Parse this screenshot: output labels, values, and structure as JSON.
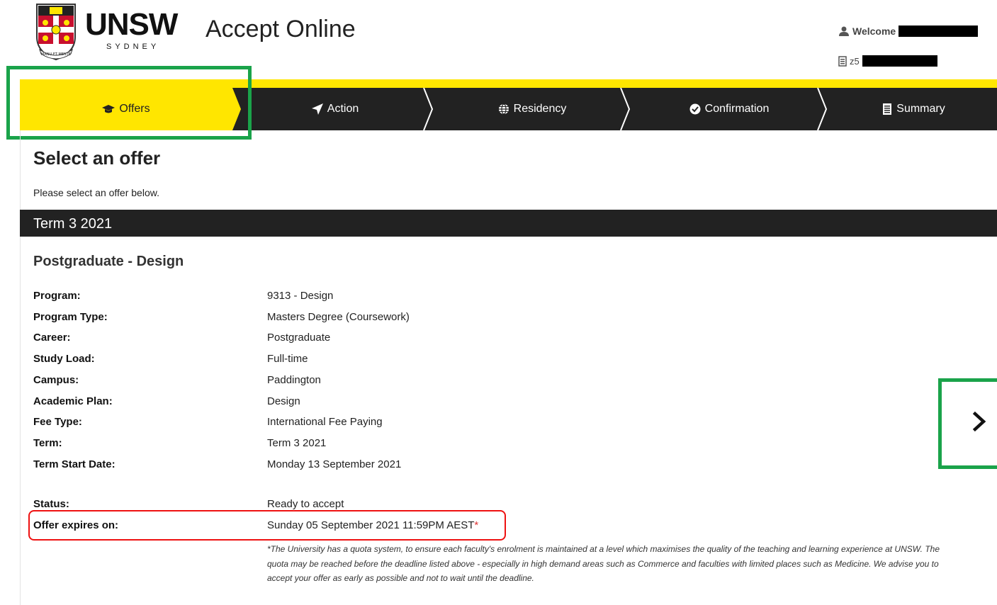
{
  "header": {
    "brand_main": "UNSW",
    "brand_sub": "SYDNEY",
    "crest_motto": "MANU ET MENTE",
    "app_title": "Accept Online",
    "welcome_label": "Welcome",
    "student_id_prefix": "z5"
  },
  "nav": {
    "steps": [
      {
        "label": "Offers",
        "icon": "graduation-cap-icon",
        "active": true
      },
      {
        "label": "Action",
        "icon": "paper-plane-icon",
        "active": false
      },
      {
        "label": "Residency",
        "icon": "globe-icon",
        "active": false
      },
      {
        "label": "Confirmation",
        "icon": "check-circle-icon",
        "active": false
      },
      {
        "label": "Summary",
        "icon": "document-icon",
        "active": false
      }
    ]
  },
  "page": {
    "title": "Select an offer",
    "subtitle": "Please select an offer below."
  },
  "term": {
    "label": "Term 3 2021"
  },
  "offer": {
    "heading": "Postgraduate - Design",
    "fields": [
      {
        "label": "Program:",
        "value": "9313 - Design"
      },
      {
        "label": "Program Type:",
        "value": "Masters Degree (Coursework)"
      },
      {
        "label": "Career:",
        "value": "Postgraduate"
      },
      {
        "label": "Study Load:",
        "value": "Full-time"
      },
      {
        "label": "Campus:",
        "value": "Paddington"
      },
      {
        "label": "Academic Plan:",
        "value": "Design"
      },
      {
        "label": "Fee Type:",
        "value": "International Fee Paying"
      },
      {
        "label": "Term:",
        "value": "Term 3 2021"
      },
      {
        "label": "Term Start Date:",
        "value": "Monday 13 September 2021"
      }
    ],
    "status_label": "Status:",
    "status_value": "Ready to accept",
    "expires_label": "Offer expires on:",
    "expires_value": "Sunday 05 September 2021 11:59PM AEST",
    "expires_marker": "*",
    "note": "*The University has a quota system, to ensure each faculty's enrolment is maintained at a level which maximises the quality of the teaching and learning experience at UNSW. The quota may be reached before the deadline listed above - especially in high demand areas such as Commerce and faculties with limited places such as Medicine. We advise you to accept your offer as early as possible and not to wait until the deadline."
  },
  "colors": {
    "accent_yellow": "#ffe600",
    "dark_bar": "#222222",
    "highlight_green": "#1aa34a",
    "highlight_red": "#ee1111"
  }
}
